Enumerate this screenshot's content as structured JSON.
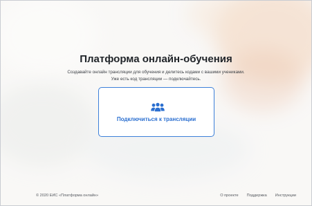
{
  "main": {
    "title": "Платформа онлайн-обучения",
    "subtitle_line1": "Создавайте онлайн трансляции для обучения и делитесь кодами с вашими учениками.",
    "subtitle_line2": "Уже есть код трансляции — подключайтесь.",
    "join_card": {
      "icon": "users-icon",
      "label": "Подключиться к трансляции",
      "accent_color": "#2b6fd0"
    }
  },
  "footer": {
    "copyright": "© 2020 ЕИС «Платформа онлайн»",
    "links": [
      {
        "label": "О проекте"
      },
      {
        "label": "Поддержка"
      },
      {
        "label": "Инструкции"
      }
    ]
  }
}
